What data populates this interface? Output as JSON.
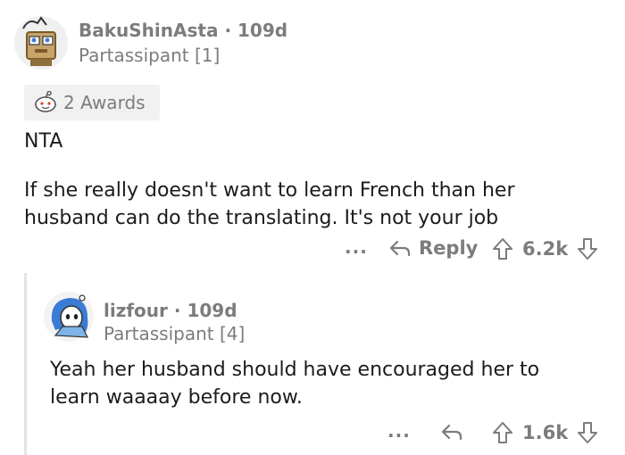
{
  "comment": {
    "username": "BakuShinAsta",
    "age": "109d",
    "flair": "Partassipant [1]",
    "awards_label": "2 Awards",
    "body_line1": "NTA",
    "body_line2": "If she really doesn't want to learn French than her",
    "body_line3": "husband can do the translating. It's not your job",
    "more_label": "...",
    "reply_label": "Reply",
    "score": "6.2k"
  },
  "reply": {
    "username": "lizfour",
    "age": "109d",
    "flair": "Partassipant [4]",
    "body_line1": "Yeah her husband should have encouraged her to",
    "body_line2": "learn waaaay before now.",
    "more_label": "...",
    "score": "1.6k"
  },
  "separator": "·",
  "icons": {
    "avatar1": "robot-avatar-icon",
    "awards": "award-icon",
    "reply": "reply-arrow-icon",
    "upvote": "upvote-arrow-icon",
    "downvote": "downvote-arrow-icon",
    "avatar2": "blue-hair-avatar-icon"
  }
}
